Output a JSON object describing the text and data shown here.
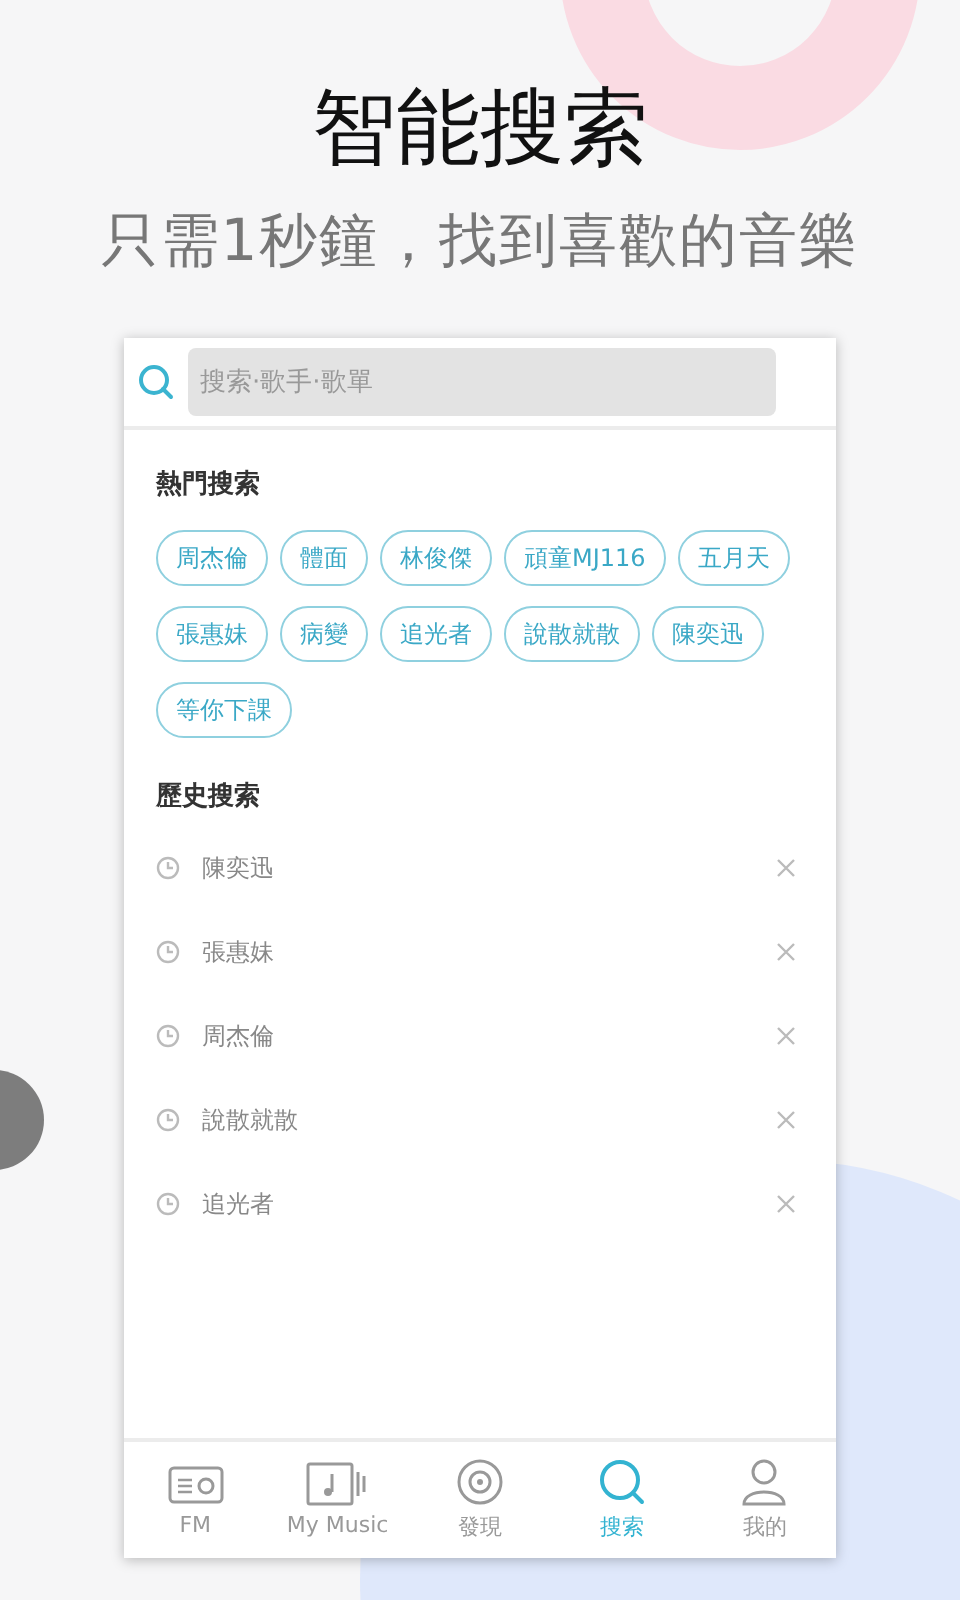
{
  "headline": "智能搜索",
  "subtitle": "只需1秒鐘，找到喜歡的音樂",
  "search": {
    "placeholder": "搜索·歌手·歌單"
  },
  "hot": {
    "title": "熱門搜索",
    "tags": [
      "周杰倫",
      "體面",
      "林俊傑",
      "頑童MJ116",
      "五月天",
      "張惠妹",
      "病變",
      "追光者",
      "說散就散",
      "陳奕迅",
      "等你下課"
    ]
  },
  "history": {
    "title": "歷史搜索",
    "items": [
      "陳奕迅",
      "張惠妹",
      "周杰倫",
      "說散就散",
      "追光者"
    ]
  },
  "tabs": [
    {
      "label": "FM",
      "kind": "radio",
      "selected": false
    },
    {
      "label": "My Music",
      "kind": "music",
      "selected": false
    },
    {
      "label": "發現",
      "kind": "disc",
      "selected": false
    },
    {
      "label": "搜索",
      "kind": "search",
      "selected": true
    },
    {
      "label": "我的",
      "kind": "user",
      "selected": false
    }
  ]
}
